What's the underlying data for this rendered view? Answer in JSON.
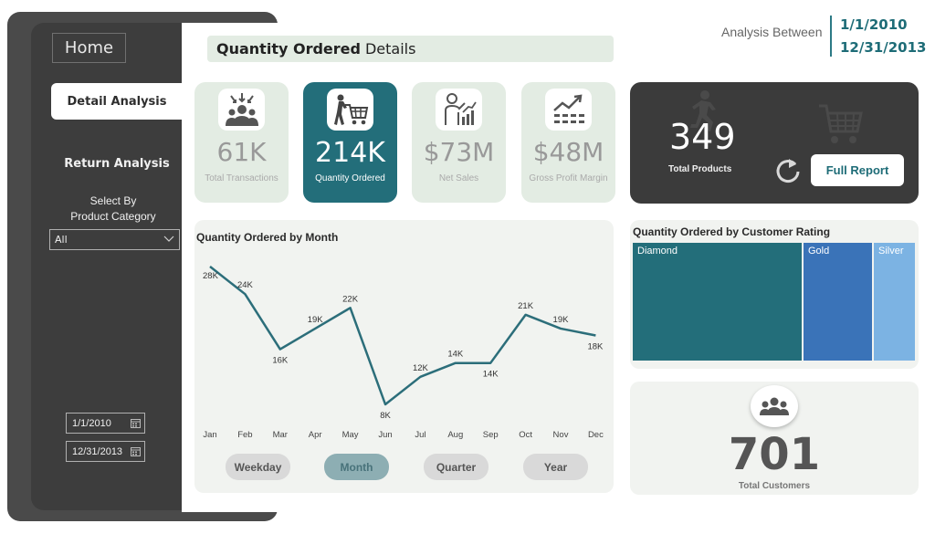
{
  "sidebar": {
    "home_label": "Home",
    "detail_label": "Detail Analysis",
    "return_label": "Return Analysis",
    "select_label_line1": "Select By",
    "select_label_line2": "Product Category",
    "select_value": "All",
    "start_date": "1/1/2010",
    "end_date": "12/31/2013"
  },
  "header": {
    "title_bold": "Quantity Ordered",
    "title_rest": "Details",
    "analysis_label": "Analysis Between",
    "date_from": "1/1/2010",
    "date_to": "12/31/2013"
  },
  "kpis": [
    {
      "value": "61K",
      "label": "Total Transactions",
      "icon": "people-icon"
    },
    {
      "value": "214K",
      "label": "Quantity Ordered",
      "icon": "shopping-cart-person-icon"
    },
    {
      "value": "$73M",
      "label": "Net Sales",
      "icon": "sales-presenter-icon"
    },
    {
      "value": "$48M",
      "label": "Gross Profit Margin",
      "icon": "trend-chart-icon"
    }
  ],
  "products": {
    "value": "349",
    "label": "Total Products",
    "button_label": "Full Report"
  },
  "line_chart": {
    "title": "Quantity Ordered by Month",
    "periods": [
      "Weekday",
      "Month",
      "Quarter",
      "Year"
    ],
    "active_period": "Month"
  },
  "chart_data": [
    {
      "type": "line",
      "title": "Quantity Ordered by Month",
      "x": [
        "Jan",
        "Feb",
        "Mar",
        "Apr",
        "May",
        "Jun",
        "Jul",
        "Aug",
        "Sep",
        "Oct",
        "Nov",
        "Dec"
      ],
      "values": [
        28,
        24,
        16,
        19,
        22,
        8,
        12,
        14,
        14,
        21,
        19,
        18
      ],
      "data_labels": [
        "28K",
        "24K",
        "16K",
        "19K",
        "22K",
        "8K",
        "12K",
        "14K",
        "14K",
        "21K",
        "19K",
        "18K"
      ],
      "ylim": [
        0,
        30
      ],
      "color": "#2c6e7a"
    },
    {
      "type": "heatmap",
      "title": "Quantity Ordered by Customer Rating",
      "categories": [
        "Diamond",
        "Gold",
        "Silver"
      ],
      "values": [
        58,
        24,
        14
      ],
      "colors": [
        "#236e7a",
        "#3a73b8",
        "#7cb3e3"
      ]
    }
  ],
  "customers": {
    "value": "701",
    "label": "Total Customers"
  }
}
